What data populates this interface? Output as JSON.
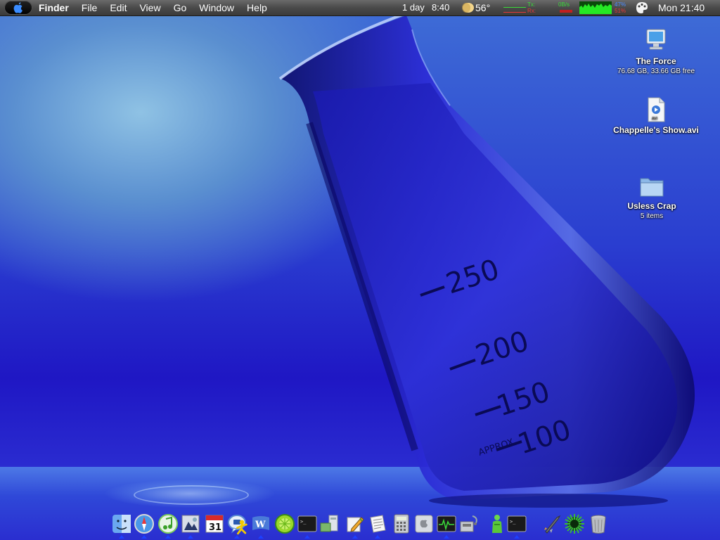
{
  "menubar": {
    "items": [
      "Finder",
      "File",
      "Edit",
      "View",
      "Go",
      "Window",
      "Help"
    ],
    "status": {
      "uptime_label": "1 day",
      "uptime_time": "8:40",
      "temperature": "56°",
      "net_tx_label": "Tx:",
      "net_rx_label": "Rx:",
      "disk_rate": "0B/s",
      "cpu_percent_top": "47%",
      "cpu_percent_bottom": "51%",
      "day_time": "Mon 21:40"
    }
  },
  "desktop_icons": [
    {
      "name": "The Force",
      "info": "76.68 GB, 33.66 GB free",
      "icon": "hard-drive-icon"
    },
    {
      "name": "Chappelle's Show.avi",
      "info": "",
      "icon": "avi-file-icon"
    },
    {
      "name": "Usless Crap",
      "info": "5 items",
      "icon": "folder-icon"
    }
  ],
  "flask_markings": [
    "250",
    "200",
    "150",
    "100",
    "APPROX"
  ],
  "dock": {
    "items": [
      {
        "name": "finder",
        "icon": "finder-icon",
        "running": true
      },
      {
        "name": "safari",
        "icon": "safari-icon",
        "running": true
      },
      {
        "name": "itunes",
        "icon": "itunes-icon",
        "running": true
      },
      {
        "name": "preview",
        "icon": "preview-icon",
        "running": true
      },
      {
        "name": "ical",
        "icon": "ical-icon",
        "running": false,
        "label": "31"
      },
      {
        "name": "ichat",
        "icon": "ichat-icon",
        "running": true
      },
      {
        "name": "aim",
        "icon": "aim-icon",
        "running": false
      },
      {
        "name": "word",
        "icon": "word-icon",
        "running": true
      },
      {
        "name": "limewire",
        "icon": "limewire-icon",
        "running": false
      },
      {
        "name": "terminal",
        "icon": "terminal-icon",
        "running": true
      },
      {
        "name": "system-utility",
        "icon": "utility-icon",
        "running": false
      },
      {
        "name": "textedit-pen",
        "icon": "pen-icon",
        "running": true
      },
      {
        "name": "text-document",
        "icon": "document-icon",
        "running": true
      },
      {
        "name": "calculator",
        "icon": "calculator-icon",
        "running": false
      },
      {
        "name": "system-preferences",
        "icon": "apple-prefs-icon",
        "running": false
      },
      {
        "name": "activity-monitor",
        "icon": "activity-monitor-icon",
        "running": true
      },
      {
        "name": "system-profiler",
        "icon": "system-profiler-icon",
        "running": false
      },
      {
        "name": "figure-app",
        "icon": "green-figure-icon",
        "running": false
      },
      {
        "name": "terminal-2",
        "icon": "terminal-icon",
        "running": true
      },
      {
        "name": "rocket-app",
        "icon": "rocket-icon",
        "running": false
      },
      {
        "name": "green-burst-app",
        "icon": "green-burst-icon",
        "running": false
      },
      {
        "name": "trash",
        "icon": "trash-icon",
        "running": false
      }
    ]
  },
  "colors": {
    "menubar": "#4a4a4a",
    "wallpaper_deep": "#1f17c4",
    "wallpaper_light": "#8fc2e4",
    "dock_indicator": "#1d3fff"
  }
}
